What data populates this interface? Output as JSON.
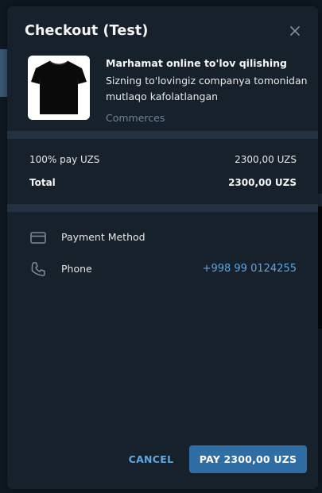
{
  "dialog": {
    "title": "Checkout (Test)"
  },
  "product": {
    "name": "Marhamat online to'lov qilishing",
    "description": "Sizning to'lovingiz companya tomonidan mutlaqo kafolatlangan",
    "shop": "Commerces",
    "image_icon": "tshirt-icon"
  },
  "prices": [
    {
      "label": "100% pay UZS",
      "value": "2300,00 UZS"
    }
  ],
  "total": {
    "label": "Total",
    "value": "2300,00 UZS"
  },
  "methods": {
    "payment": {
      "label": "Payment Method",
      "icon": "credit-card-icon"
    },
    "phone": {
      "label": "Phone",
      "value": "+998 99 0124255",
      "icon": "phone-icon"
    }
  },
  "buttons": {
    "cancel": "CANCEL",
    "pay": "PAY 2300,00 UZS"
  },
  "colors": {
    "background": "#17212b",
    "separator": "#243140",
    "accent": "#5ea7e0",
    "pay_button": "#2f6ea5",
    "muted": "#708499"
  }
}
